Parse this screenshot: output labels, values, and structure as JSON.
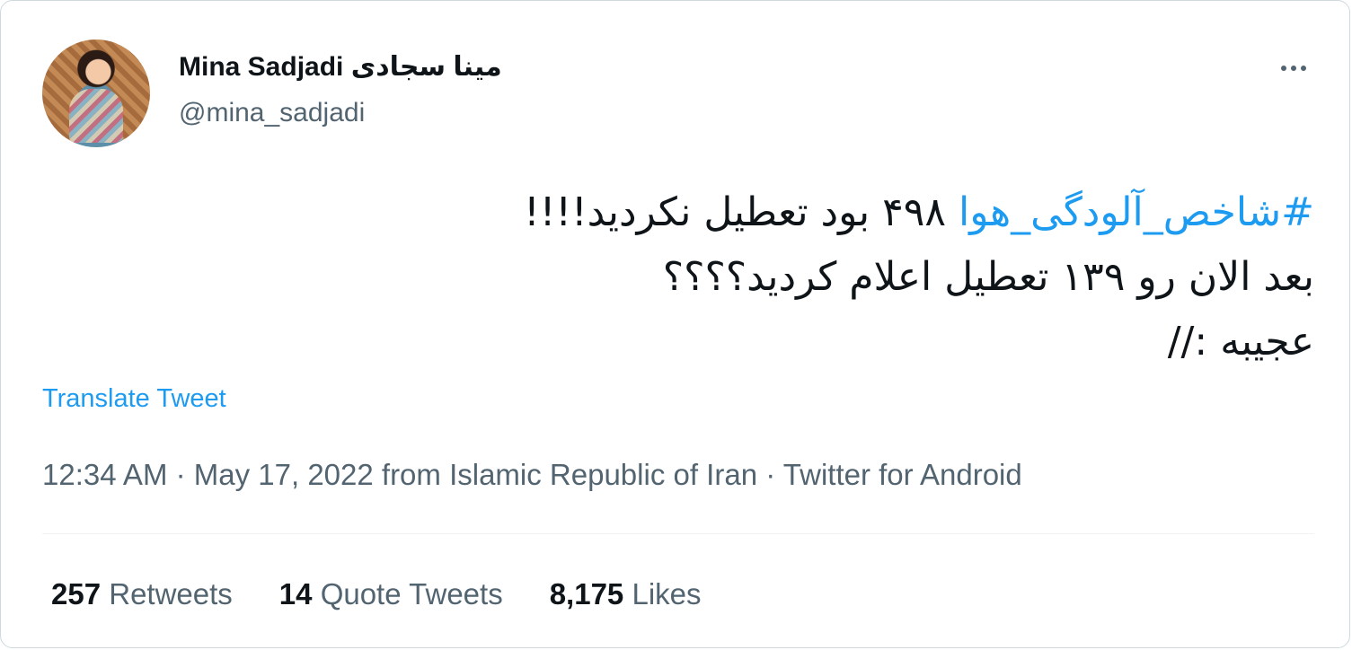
{
  "author": {
    "display_name": "Mina Sadjadi مینا سجادی",
    "handle": "@mina_sadjadi"
  },
  "tweet": {
    "hashtag": "#شاخص_آلودگی_هوا",
    "line1_rest": " ۴۹۸ بود تعطیل نکردید!!!!",
    "line2": "بعد الان رو ۱۳۹ تعطیل اعلام کردید؟؟؟؟",
    "line3": "عجیبه ://"
  },
  "translate_label": "Translate Tweet",
  "meta": {
    "time": "12:34 AM",
    "separator": " · ",
    "date": "May 17, 2022",
    "location": " from Islamic Republic of Iran",
    "source": "Twitter for Android"
  },
  "stats": {
    "retweets_count": "257",
    "retweets_label": "Retweets",
    "quotes_count": "14",
    "quotes_label": "Quote Tweets",
    "likes_count": "8,175",
    "likes_label": "Likes"
  },
  "icons": {
    "more": "more-horizontal-icon"
  },
  "colors": {
    "accent": "#1d9bf0",
    "text": "#0f1419",
    "secondary": "#536471",
    "border": "#cfd9de"
  }
}
